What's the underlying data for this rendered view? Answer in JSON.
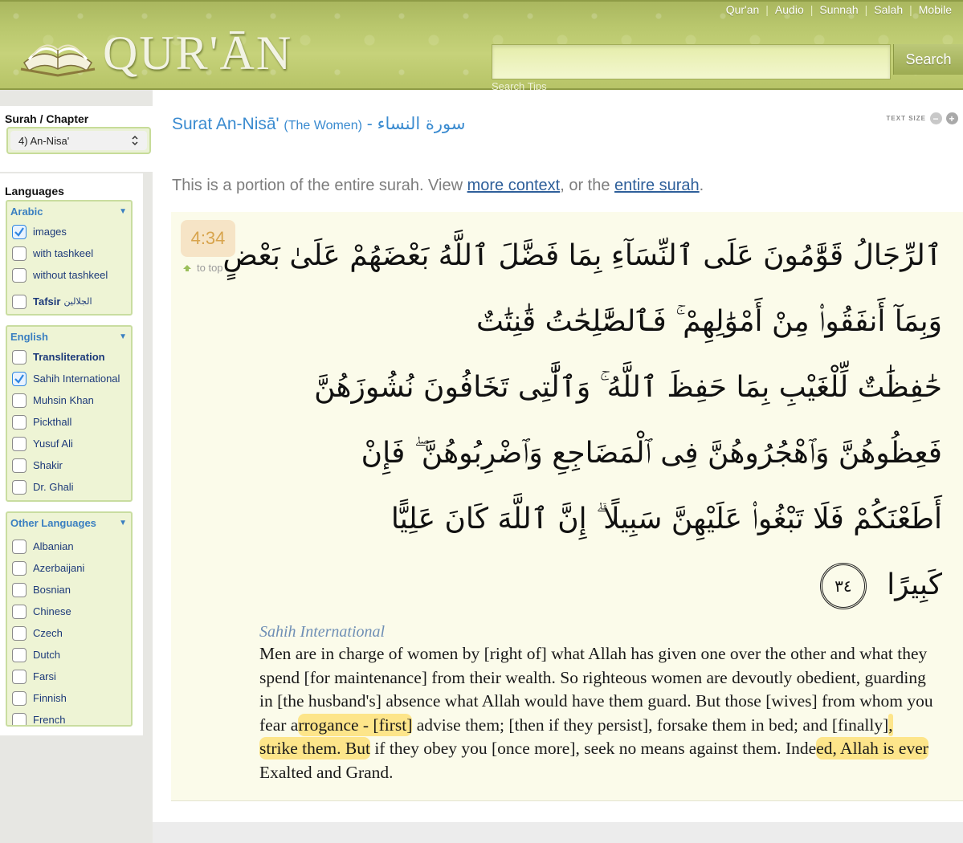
{
  "header": {
    "logo_text": "QUR'ĀN",
    "nav": [
      "Qur'an",
      "Audio",
      "Sunnah",
      "Salah",
      "Mobile"
    ],
    "search": {
      "value": "",
      "button_label": "Search",
      "tips_label": "Search Tips"
    }
  },
  "sidebar": {
    "surah_title": "Surah / Chapter",
    "surah_selected": "4) An-Nisa'",
    "languages_title": "Languages",
    "groups": [
      {
        "title": "Arabic",
        "options": [
          {
            "label": "images",
            "checked": true,
            "bold": false
          },
          {
            "label": "with tashkeel",
            "checked": false,
            "bold": false
          },
          {
            "label": "without tashkeel",
            "checked": false,
            "bold": false
          },
          {
            "label": "Tafsir",
            "extra": "الجلالين",
            "checked": false,
            "bold": true
          }
        ]
      },
      {
        "title": "English",
        "options": [
          {
            "label": "Transliteration",
            "checked": false,
            "bold": true
          },
          {
            "label": "Sahih International",
            "checked": true,
            "bold": false
          },
          {
            "label": "Muhsin Khan",
            "checked": false,
            "bold": false
          },
          {
            "label": "Pickthall",
            "checked": false,
            "bold": false
          },
          {
            "label": "Yusuf Ali",
            "checked": false,
            "bold": false
          },
          {
            "label": "Shakir",
            "checked": false,
            "bold": false
          },
          {
            "label": "Dr. Ghali",
            "checked": false,
            "bold": false
          }
        ]
      },
      {
        "title": "Other Languages",
        "options": [
          {
            "label": "Albanian",
            "checked": false,
            "bold": false
          },
          {
            "label": "Azerbaijani",
            "checked": false,
            "bold": false
          },
          {
            "label": "Bosnian",
            "checked": false,
            "bold": false
          },
          {
            "label": "Chinese",
            "checked": false,
            "bold": false
          },
          {
            "label": "Czech",
            "checked": false,
            "bold": false
          },
          {
            "label": "Dutch",
            "checked": false,
            "bold": false
          },
          {
            "label": "Farsi",
            "checked": false,
            "bold": false
          },
          {
            "label": "Finnish",
            "checked": false,
            "bold": false
          },
          {
            "label": "French",
            "checked": false,
            "bold": false
          }
        ]
      }
    ]
  },
  "main": {
    "title": "Surat An-Nisā'",
    "title_sub": "(The Women)",
    "title_dash": "-",
    "title_arabic": "سورة النساء",
    "text_size_label": "TEXT SIZE",
    "text_size_minus": "−",
    "text_size_plus": "+",
    "context": {
      "prefix": "This is a portion of the entire surah. View ",
      "link1": "more context",
      "middle": ", or the ",
      "link2": "entire surah",
      "suffix": "."
    },
    "verse": {
      "number": "4:34",
      "to_top": "to top",
      "arabic_lines": [
        "ٱلرِّجَالُ قَوَّٰمُونَ عَلَى ٱلنِّسَآءِ بِمَا فَضَّلَ ٱللَّهُ بَعْضَهُمْ عَلَىٰ بَعْضٍ",
        "وَبِمَآ أَنفَقُوا۟ مِنْ أَمْوَٰلِهِمْ ۚ فَٱلصَّٰلِحَٰتُ قَٰنِتَٰتٌ",
        "حَٰفِظَٰتٌ لِّلْغَيْبِ بِمَا حَفِظَ ٱللَّهُ ۚ وَٱلَّٰتِى تَخَافُونَ نُشُوزَهُنَّ",
        "فَعِظُوهُنَّ وَٱهْجُرُوهُنَّ فِى ٱلْمَضَاجِعِ وَٱضْرِبُوهُنَّ ۖ فَإِنْ",
        "أَطَعْنَكُمْ فَلَا تَبْغُوا۟ عَلَيْهِنَّ سَبِيلًا ۗ إِنَّ ٱللَّهَ كَانَ عَلِيًّا",
        "كَبِيرًا"
      ],
      "ayah_mark": "٣٤",
      "translator": "Sahih International",
      "translation": [
        {
          "t": "Men are in charge of women by [right of] what Allah has given one over the other and what they spend [for maintenance] from their wealth. So righteous women are devoutly obedient, guarding in [the husband's] absence what Allah would have them guard. But those [wives] from whom you fear a",
          "hl": false
        },
        {
          "t": "rrogance - [first]",
          "hl": true
        },
        {
          "t": " advise them; [then if they persist], forsake them in bed; and [finally]",
          "hl": false
        },
        {
          "t": ", strike them. But",
          "hl": true
        },
        {
          "t": " if they obey you [once more], seek no means against them. Inde",
          "hl": false
        },
        {
          "t": "ed, Allah is ever",
          "hl": true
        },
        {
          "t": " Exalted and Grand.",
          "hl": false
        }
      ]
    }
  },
  "colors": {
    "header_green": "#b9c76d",
    "link_blue": "#3a8bd0",
    "highlight": "#fde58a",
    "verse_badge": "#f6e4c6"
  }
}
